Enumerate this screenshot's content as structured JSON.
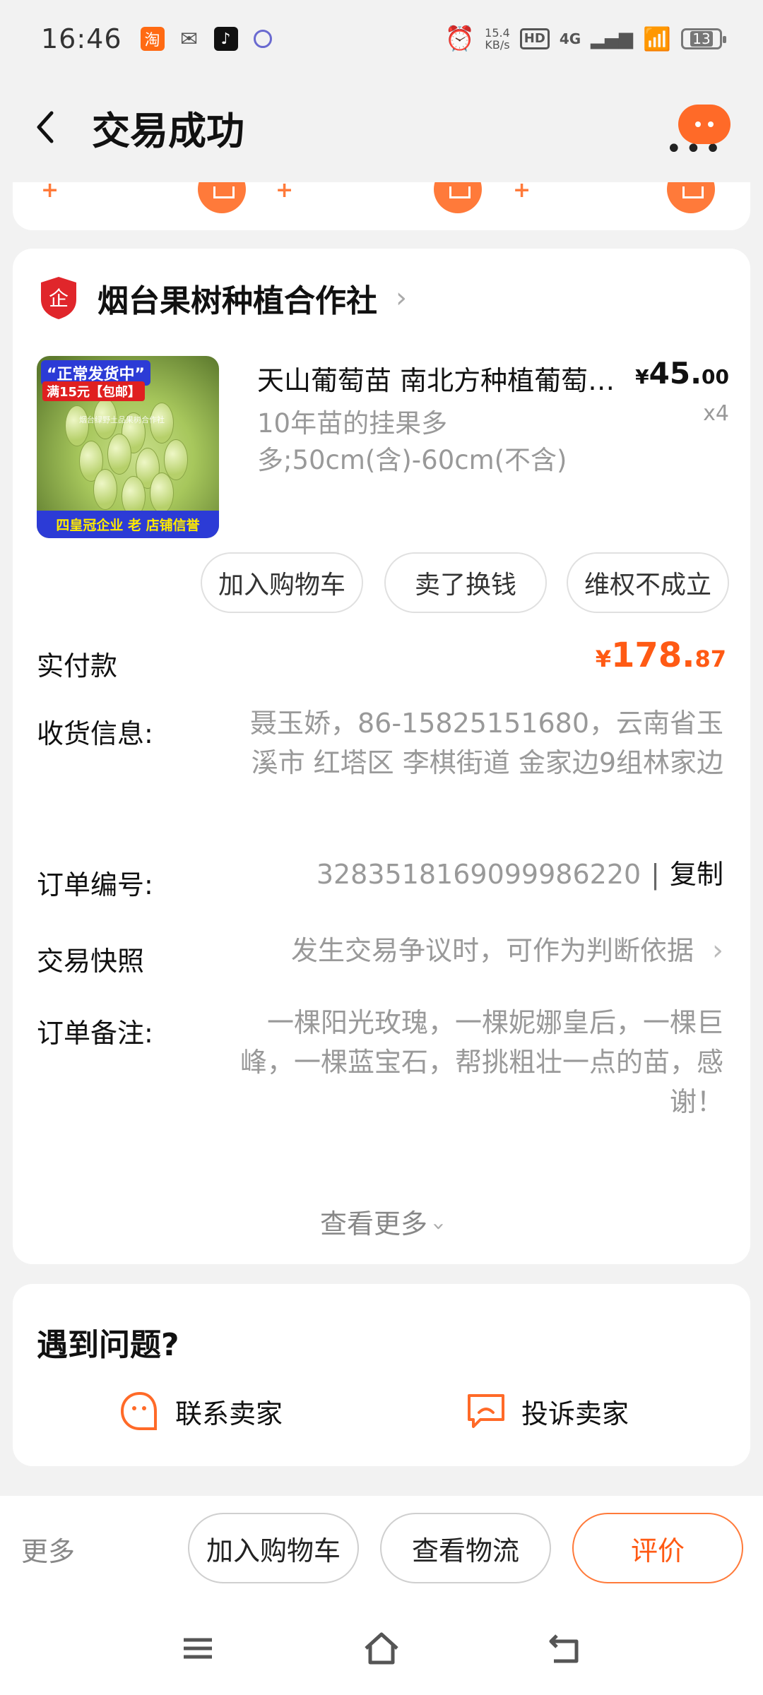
{
  "status_bar": {
    "time": "16:46",
    "net_speed_value": "15.4",
    "net_speed_unit": "KB/s",
    "hd": "HD",
    "network": "4G",
    "battery": "13"
  },
  "header": {
    "title": "交易成功"
  },
  "order": {
    "shop_name": "烟台果树种植合作社",
    "product": {
      "title": "天山葡萄苗 南北方种植葡萄树苗",
      "spec": "10年苗的挂果多多;50cm(含)-60cm(不含)",
      "price_symbol": "¥",
      "price_int": "45.",
      "price_dec": "00",
      "quantity": "x4",
      "image_text_top": "“正常发货中”",
      "image_text_sub": "满15元【包邮】",
      "image_text_mark": "烟台绿野土品果树合作社",
      "image_text_bottom": "四皇冠企业 老 店铺信誉"
    },
    "actions": [
      "加入购物车",
      "卖了换钱",
      "维权不成立"
    ],
    "payment_label": "实付款",
    "payment_symbol": "¥",
    "payment_int": "178.",
    "payment_dec": "87",
    "address_label": "收货信息:",
    "address_value": "聂玉娇，86-15825151680，云南省玉溪市 红塔区 李棋街道 金家边9组林家边",
    "order_no_label": "订单编号:",
    "order_no_value": "3283518169099986220",
    "order_no_sep": "|",
    "copy_label": "复制",
    "snapshot_label": "交易快照",
    "snapshot_value": "发生交易争议时，可作为判断依据",
    "note_label": "订单备注:",
    "note_value": "一棵阳光玫瑰，一棵妮娜皇后，一棵巨峰，一棵蓝宝石，帮挑粗壮一点的苗，感谢！",
    "see_more": "查看更多"
  },
  "help": {
    "title": "遇到问题?",
    "contact_seller": "联系卖家",
    "complain_seller": "投诉卖家"
  },
  "bottom_bar": {
    "more": "更多",
    "add_to_cart": "加入购物车",
    "view_logistics": "查看物流",
    "review": "评价"
  },
  "colors": {
    "accent": "#ff5a14",
    "page_bg": "#f2f2f2",
    "muted_text": "#999999"
  }
}
